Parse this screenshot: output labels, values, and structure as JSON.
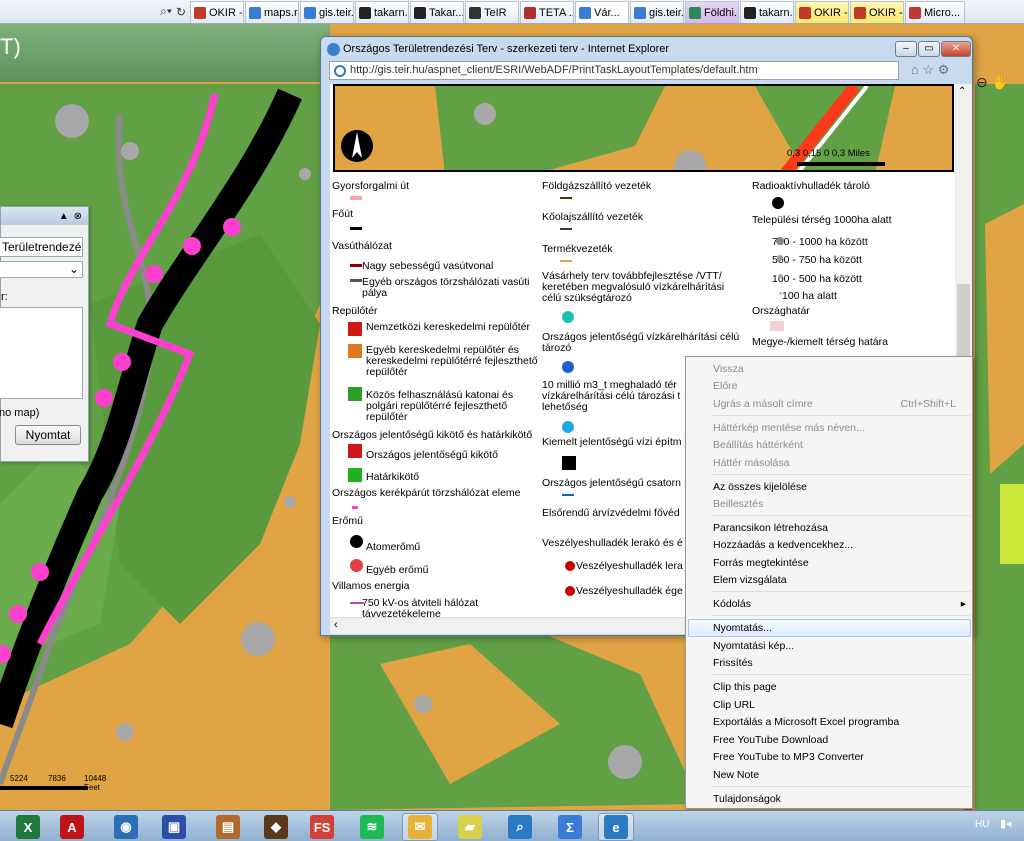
{
  "browser": {
    "address_tail_icons": [
      "search-icon",
      "refresh-icon"
    ],
    "tabs": [
      {
        "label": "OKIR -...",
        "color": "#c0392b",
        "style": ""
      },
      {
        "label": "maps.r...",
        "color": "#3a7bd5",
        "style": ""
      },
      {
        "label": "gis.teir...",
        "color": "#3a7bd5",
        "style": ""
      },
      {
        "label": "takarn...",
        "color": "#222222",
        "style": ""
      },
      {
        "label": "Takar...",
        "color": "#222222",
        "style": ""
      },
      {
        "label": "TeIR",
        "color": "#333333",
        "style": ""
      },
      {
        "label": "TETA ...",
        "color": "#b03030",
        "style": ""
      },
      {
        "label": "Vár...",
        "color": "#3a7bd5",
        "style": "active"
      },
      {
        "label": "gis.teir...",
        "color": "#3a7bd5",
        "style": ""
      },
      {
        "label": "Földhi...",
        "color": "#2e8b57",
        "style": "purple"
      },
      {
        "label": "takarn...",
        "color": "#222222",
        "style": ""
      },
      {
        "label": "OKIR -...",
        "color": "#c0392b",
        "style": "pink"
      },
      {
        "label": "OKIR -...",
        "color": "#c0392b",
        "style": "pink"
      },
      {
        "label": "Micro...",
        "color": "#c0392b",
        "style": ""
      }
    ]
  },
  "mapheader": {
    "text": "T)"
  },
  "leftpanel": {
    "input1": "Területrendezé",
    "label": "r:",
    "note": "no map)",
    "print_button": "Nyomtat"
  },
  "scalebar": {
    "ticks": [
      "5224",
      "7836",
      "10448 Feet"
    ]
  },
  "popup": {
    "title": "Országos Területrendezési Terv - szerkezeti terv - Internet Explorer",
    "url": "http://gis.teir.hu/aspnet_client/ESRI/WebADF/PrintTaskLayoutTemplates/default.htm",
    "scale": "0,3   0,15     0              0,3 Miles",
    "legend_col1": [
      "Gyorsforgalmi út",
      "Főút",
      "Vasúthálózat",
      "Nagy sebességű vasútvonal",
      "Egyéb országos törzshálózati vasúti",
      "pálya",
      "Repülőtér",
      "Nemzetközi kereskedelmi repülőtér",
      "Egyéb kereskedelmi repülőtér és",
      "kereskedelmi repülőtérré fejleszthető",
      "repülőtér",
      "Közös felhasználású katonai és",
      "polgári repülőtérré fejleszthető",
      "repülőtér",
      "Országos jelentőségű kikötő és határkikötő",
      "Országos jelentőségű kikötő",
      "Határkikötő",
      "Országos kerékpárút törzshálózat eleme",
      "Erőmű",
      "Atomerőmű",
      "Egyéb erőmű",
      "Villamos energia",
      "750 kV-os átviteli hálózat",
      "távvezetékeleme"
    ],
    "legend_col2": [
      "Földgázszállító vezeték",
      "Kőolajszállító vezeték",
      "Termékvezeték",
      "Vásárhely terv továbbfejlesztése /VTT/",
      "keretében megvalósuló vízkárelhárítási",
      "célú szükségtározó",
      "Országos jelentőségű vízkárelhárítási célú",
      "tározó",
      "10 millió m3_t meghaladó tér",
      "vízkárelhárítási célú tározási t",
      "lehetőség",
      "Kiemelt jelentőségű vízi építm",
      "Országos jelentőségű csatorn",
      "Elsőrendű árvízvédelmi fővéd",
      "Veszélyeshulladék lerakó és é",
      "Veszélyeshulladék lera",
      "Veszélyeshulladék ége"
    ],
    "legend_col3": [
      "Radioaktívhulladék tároló",
      "Települési térség 1000ha alatt",
      "750 - 1000 ha között",
      "500 - 750 ha között",
      "100 - 500 ha között",
      "100 ha alatt",
      "Országhatár",
      "Megye-/kiemelt térség határa"
    ]
  },
  "context_menu": {
    "items": [
      {
        "label": "Vissza",
        "disabled": true
      },
      {
        "label": "Előre",
        "disabled": true
      },
      {
        "label": "Ugrás a másolt címre",
        "disabled": true,
        "shortcut": "Ctrl+Shift+L"
      },
      {
        "label": "Háttérkép mentése más néven...",
        "disabled": true
      },
      {
        "label": "Beállítás háttérként",
        "disabled": true
      },
      {
        "label": "Háttér másolása",
        "disabled": true
      },
      {
        "label": "Az összes kijelölése",
        "disabled": false
      },
      {
        "label": "Beillesztés",
        "disabled": true
      },
      {
        "label": "Parancsikon létrehozása",
        "disabled": false
      },
      {
        "label": "Hozzáadás a kedvencekhez...",
        "disabled": false
      },
      {
        "label": "Forrás megtekintése",
        "disabled": false
      },
      {
        "label": "Elem vizsgálata",
        "disabled": false
      },
      {
        "label": "Kódolás",
        "disabled": false
      },
      {
        "label": "Nyomtatás...",
        "disabled": false
      },
      {
        "label": "Nyomtatási kép...",
        "disabled": false
      },
      {
        "label": "Frissítés",
        "disabled": false
      },
      {
        "label": "Clip this page",
        "disabled": false
      },
      {
        "label": "Clip URL",
        "disabled": false
      },
      {
        "label": "Exportálás a Microsoft Excel programba",
        "disabled": false
      },
      {
        "label": "Free YouTube Download",
        "disabled": false
      },
      {
        "label": "Free YouTube to MP3 Converter",
        "disabled": false
      },
      {
        "label": "New Note",
        "disabled": false
      },
      {
        "label": "Tulajdonságok",
        "disabled": false
      }
    ],
    "submenu_arrow": "▸"
  },
  "taskbar": {
    "lang": "HU",
    "apps": [
      {
        "name": "excel-icon",
        "glyph": "X",
        "color": "#1f7a3c"
      },
      {
        "name": "acrobat-icon",
        "glyph": "A",
        "color": "#c0141b"
      },
      {
        "name": "globe-app-icon",
        "glyph": "◉",
        "color": "#2d6fb5"
      },
      {
        "name": "save-disk-icon",
        "glyph": "▣",
        "color": "#2b4fa8"
      },
      {
        "name": "book-icon",
        "glyph": "▤",
        "color": "#b06a2a"
      },
      {
        "name": "arc-icon",
        "glyph": "◆",
        "color": "#5a3a1a"
      },
      {
        "name": "fs-icon",
        "glyph": "FS",
        "color": "#d2403a"
      },
      {
        "name": "spotify-icon",
        "glyph": "≋",
        "color": "#1db954"
      },
      {
        "name": "mail-icon",
        "glyph": "✉",
        "color": "#e8b23a"
      },
      {
        "name": "sticky-notes-icon",
        "glyph": "▰",
        "color": "#d8d04a"
      },
      {
        "name": "magnifier-icon",
        "glyph": "⌕",
        "color": "#2b78c4"
      },
      {
        "name": "math-icon",
        "glyph": "Σ",
        "color": "#3a7bd5"
      },
      {
        "name": "ie-icon",
        "glyph": "e",
        "color": "#2b78c4"
      }
    ]
  }
}
